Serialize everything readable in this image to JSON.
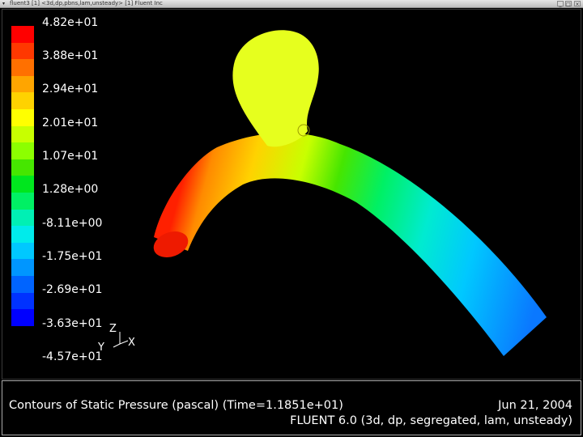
{
  "window": {
    "title": "fluent3 [1] <3d,dp,pbns,lam,unsteady> [1] Fluent Inc",
    "menu_glyph": "▾",
    "minimize_glyph": "_",
    "maximize_glyph": "□",
    "close_glyph": "×"
  },
  "legend": {
    "colors": [
      "#ff0000",
      "#ff3800",
      "#ff7000",
      "#ffa500",
      "#ffd200",
      "#ffff00",
      "#c8ff00",
      "#8cff00",
      "#46e600",
      "#00e61e",
      "#00f064",
      "#00f0b4",
      "#00ebeb",
      "#00c8ff",
      "#0096ff",
      "#0064ff",
      "#0032ff",
      "#0000ff"
    ],
    "labels": [
      "4.82e+01",
      "3.88e+01",
      "2.94e+01",
      "2.01e+01",
      "1.07e+01",
      "1.28e+00",
      "-8.11e+00",
      "-1.75e+01",
      "-2.69e+01",
      "-3.63e+01",
      "-4.57e+01"
    ]
  },
  "axes_triad": {
    "z": "Z",
    "y": "Y",
    "x": "X"
  },
  "caption": {
    "title": "Contours of Static Pressure (pascal)  (Time=1.1851e+01)",
    "date": "Jun 21, 2004",
    "solver": "FLUENT 6.0 (3d, dp, segregated, lam, unsteady)"
  }
}
